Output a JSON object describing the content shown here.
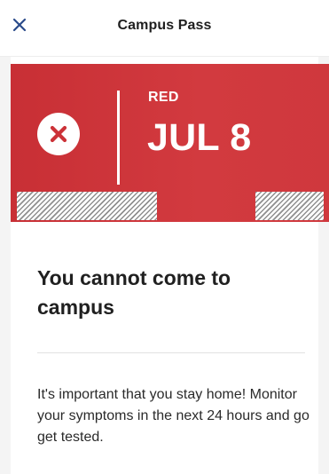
{
  "header": {
    "close_label": "X",
    "title": "Campus Pass"
  },
  "status": {
    "label": "RED",
    "date": "JUL 8",
    "icon": "x-circle-icon",
    "color": "#cc3238"
  },
  "message": {
    "headline": "You cannot come to campus",
    "body": "It's important that you stay home! Monitor your symptoms in the next 24 hours and go get tested."
  }
}
